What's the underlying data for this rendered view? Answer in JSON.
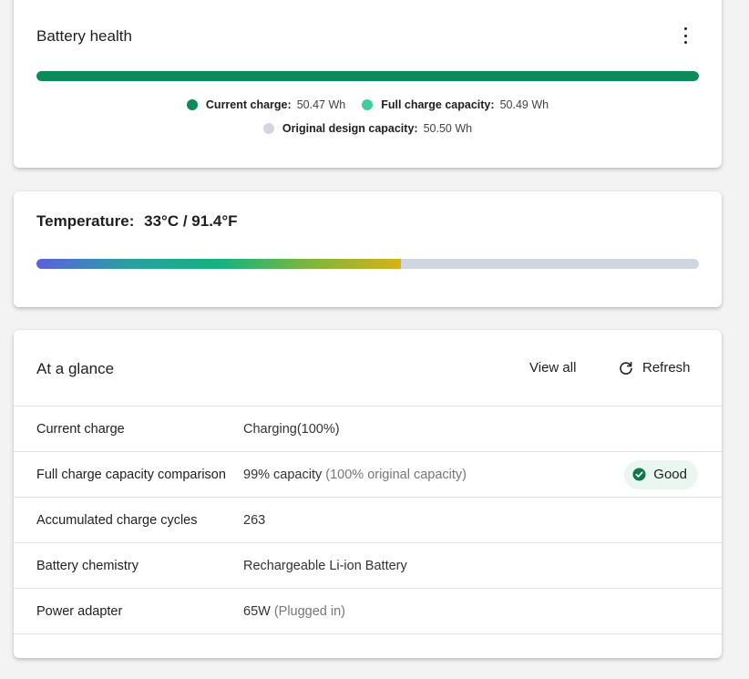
{
  "battery_health": {
    "title": "Battery health",
    "current_charge_fraction": 0.9994,
    "colors": {
      "current_charge": "#0b8a5a",
      "full_charge_capacity": "#3ecf9b",
      "original_design_capacity": "#cfd6e2"
    },
    "legend": {
      "current_charge_label": "Current charge:",
      "current_charge_value": "50.47 Wh",
      "full_charge_label": "Full charge capacity:",
      "full_charge_value": "50.49 Wh",
      "design_label": "Original design capacity:",
      "design_value": "50.50 Wh"
    },
    "more_icon": "more-vertical-icon"
  },
  "temperature": {
    "label": "Temperature:",
    "value": "33°C / 91.4°F",
    "level_fraction": 0.55
  },
  "glance": {
    "title": "At a glance",
    "view_all_label": "View all",
    "refresh_label": "Refresh",
    "refresh_icon": "refresh-icon",
    "rows": [
      {
        "label": "Current charge",
        "value": "Charging(100%)",
        "note": ""
      },
      {
        "label": "Full charge capacity comparison",
        "value": "99% capacity",
        "note": "(100% original capacity)",
        "status": "Good",
        "status_icon": "check-circle-icon",
        "status_color": "#0b7a4b"
      },
      {
        "label": "Accumulated charge cycles",
        "value": "263",
        "note": ""
      },
      {
        "label": "Battery chemistry",
        "value": "Rechargeable Li-ion Battery",
        "note": ""
      },
      {
        "label": "Power adapter",
        "value": "65W",
        "note": "(Plugged in)"
      }
    ]
  }
}
